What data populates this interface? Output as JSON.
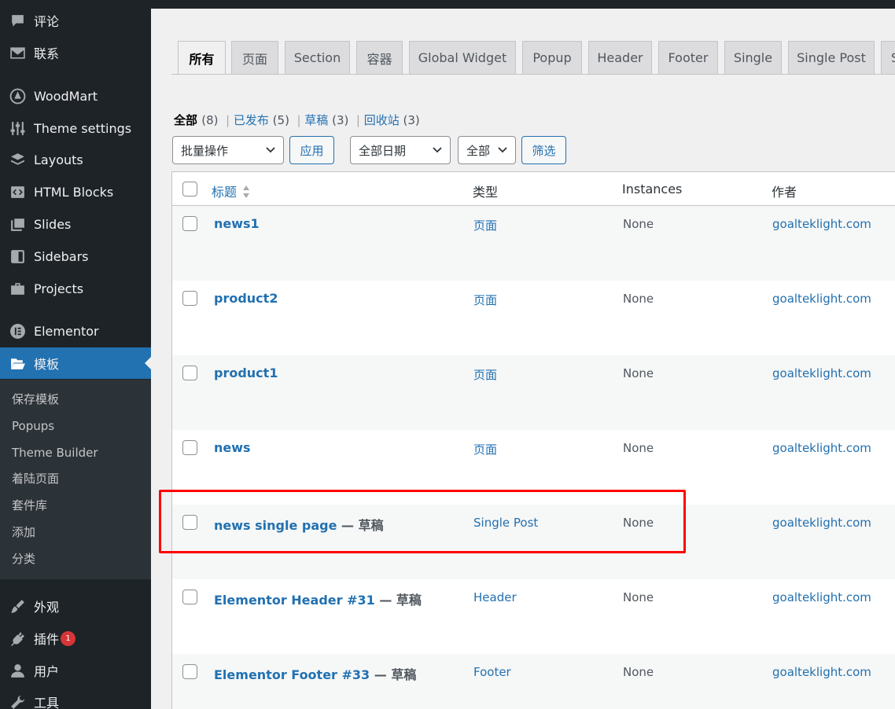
{
  "sidebar": {
    "items": [
      {
        "label": "评论",
        "icon": "comment-icon"
      },
      {
        "label": "联系",
        "icon": "mail-icon"
      },
      {
        "label": "WoodMart",
        "icon": "woodmart-icon"
      },
      {
        "label": "Theme settings",
        "icon": "settings-sliders-icon"
      },
      {
        "label": "Layouts",
        "icon": "layers-icon"
      },
      {
        "label": "HTML Blocks",
        "icon": "code-block-icon"
      },
      {
        "label": "Slides",
        "icon": "slides-icon"
      },
      {
        "label": "Sidebars",
        "icon": "sidebar-icon"
      },
      {
        "label": "Projects",
        "icon": "briefcase-icon"
      },
      {
        "label": "Elementor",
        "icon": "elementor-icon"
      },
      {
        "label": "模板",
        "icon": "folder-open-icon"
      },
      {
        "label": "外观",
        "icon": "paintbrush-icon"
      },
      {
        "label": "插件",
        "icon": "plugin-icon",
        "badge": "1"
      },
      {
        "label": "用户",
        "icon": "user-icon"
      },
      {
        "label": "工具",
        "icon": "wrench-icon"
      }
    ],
    "submenu": [
      "保存模板",
      "Popups",
      "Theme Builder",
      "着陆页面",
      "套件库",
      "添加",
      "分类"
    ]
  },
  "tabs": [
    "所有",
    "页面",
    "Section",
    "容器",
    "Global Widget",
    "Popup",
    "Header",
    "Footer",
    "Single",
    "Single Post",
    "S"
  ],
  "filters": {
    "all": "全部",
    "all_count": "(8)",
    "published": "已发布",
    "published_count": "(5)",
    "draft": "草稿",
    "draft_count": "(3)",
    "trash": "回收站",
    "trash_count": "(3)",
    "bulk_action": "批量操作",
    "apply": "应用",
    "date": "全部日期",
    "type": "全部",
    "filter": "筛选"
  },
  "table": {
    "headers": {
      "title": "标题",
      "type": "类型",
      "instances": "Instances",
      "author": "作者"
    },
    "rows": [
      {
        "title": "news1",
        "state": "",
        "type": "页面",
        "instances": "None",
        "author": "goalteklight.com"
      },
      {
        "title": "product2",
        "state": "",
        "type": "页面",
        "instances": "None",
        "author": "goalteklight.com"
      },
      {
        "title": "product1",
        "state": "",
        "type": "页面",
        "instances": "None",
        "author": "goalteklight.com"
      },
      {
        "title": "news",
        "state": "",
        "type": "页面",
        "instances": "None",
        "author": "goalteklight.com"
      },
      {
        "title": "news single page",
        "state": " — 草稿",
        "type": "Single Post",
        "instances": "None",
        "author": "goalteklight.com"
      },
      {
        "title": "Elementor Header #31",
        "state": " — 草稿",
        "type": "Header",
        "instances": "None",
        "author": "goalteklight.com"
      },
      {
        "title": "Elementor Footer #33",
        "state": " — 草稿",
        "type": "Footer",
        "instances": "None",
        "author": "goalteklight.com"
      }
    ]
  },
  "colors": {
    "accent": "#2271b1",
    "sidebar_bg": "#1d2327",
    "highlight": "#ff0000"
  }
}
